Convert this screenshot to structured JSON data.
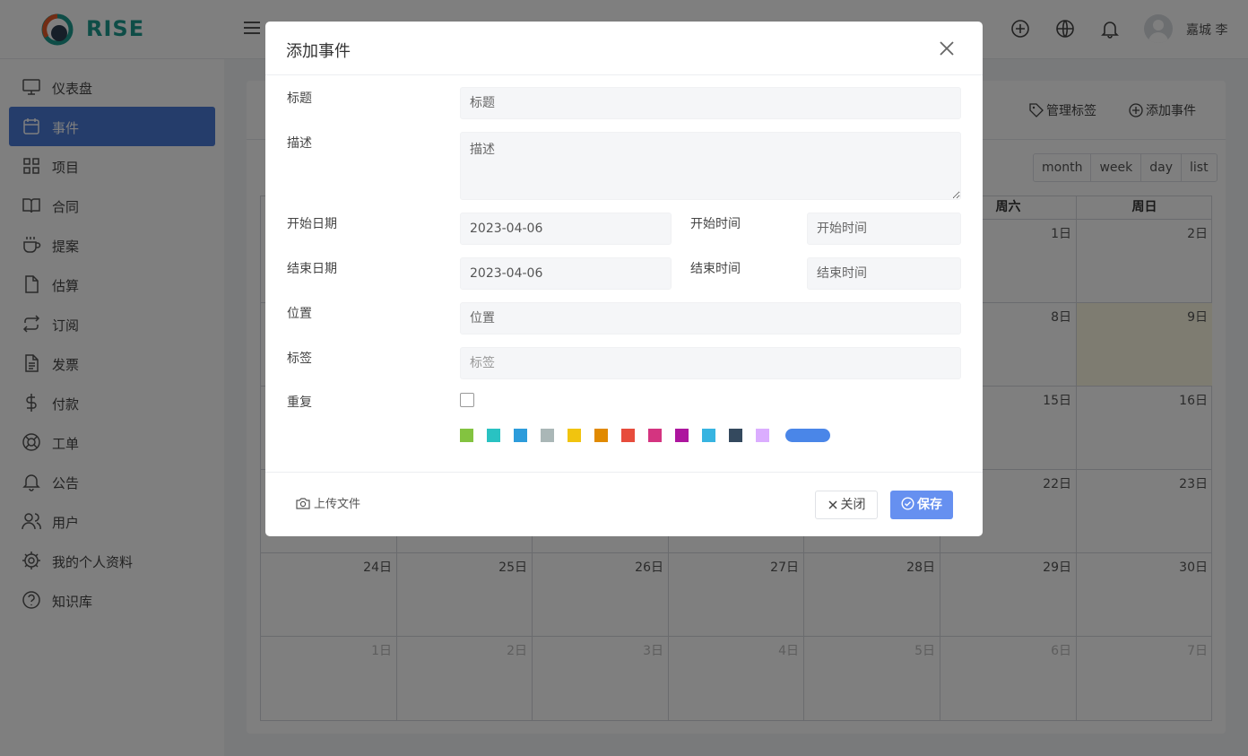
{
  "app": {
    "name": "RISE",
    "user_name": "嘉城 李"
  },
  "sidebar": {
    "items": [
      {
        "label": "仪表盘",
        "icon": "monitor-icon"
      },
      {
        "label": "事件",
        "icon": "calendar-icon",
        "active": true
      },
      {
        "label": "项目",
        "icon": "grid-icon"
      },
      {
        "label": "合同",
        "icon": "book-icon"
      },
      {
        "label": "提案",
        "icon": "coffee-icon"
      },
      {
        "label": "估算",
        "icon": "file-icon"
      },
      {
        "label": "订阅",
        "icon": "repeat-icon"
      },
      {
        "label": "发票",
        "icon": "file-text-icon"
      },
      {
        "label": "付款",
        "icon": "dollar-icon"
      },
      {
        "label": "工单",
        "icon": "life-buoy-icon"
      },
      {
        "label": "公告",
        "icon": "bell-icon"
      },
      {
        "label": "用户",
        "icon": "users-icon"
      },
      {
        "label": "我的个人资料",
        "icon": "settings-icon"
      },
      {
        "label": "知识库",
        "icon": "help-circle-icon"
      }
    ]
  },
  "events_page": {
    "manage_labels_label": "管理标签",
    "add_event_label": "添加事件",
    "view_buttons": [
      "month",
      "week",
      "day",
      "list"
    ],
    "weekday_headers": {
      "sat": "周六",
      "sun": "周日"
    },
    "weeks": [
      [
        "",
        "",
        "",
        "",
        "",
        "1日",
        "2日"
      ],
      [
        "",
        "",
        "",
        "",
        "",
        "8日",
        "9日"
      ],
      [
        "",
        "",
        "",
        "",
        "",
        "15日",
        "16日"
      ],
      [
        "",
        "",
        "",
        "",
        "",
        "22日",
        "23日"
      ],
      [
        "24日",
        "25日",
        "26日",
        "27日",
        "28日",
        "29日",
        "30日"
      ],
      [
        "1日",
        "2日",
        "3日",
        "4日",
        "5日",
        "6日",
        "7日"
      ]
    ],
    "today": "9日"
  },
  "modal": {
    "title": "添加事件",
    "fields": {
      "title": {
        "label": "标题",
        "placeholder": "标题"
      },
      "description": {
        "label": "描述",
        "placeholder": "描述"
      },
      "start_date": {
        "label": "开始日期",
        "value": "2023-04-06"
      },
      "start_time": {
        "label": "开始时间",
        "placeholder": "开始时间"
      },
      "end_date": {
        "label": "结束日期",
        "value": "2023-04-06"
      },
      "end_time": {
        "label": "结束时间",
        "placeholder": "结束时间"
      },
      "location": {
        "label": "位置",
        "placeholder": "位置"
      },
      "labels": {
        "label": "标签",
        "placeholder": "标签"
      },
      "repeat": {
        "label": "重复",
        "checked": false
      }
    },
    "colors": [
      "#83c340",
      "#29c2c2",
      "#2d9cdb",
      "#aab7b7",
      "#f1c40f",
      "#e18a00",
      "#e74c3c",
      "#d43480",
      "#ad159e",
      "#37b4e1",
      "#34495e",
      "#dbadff"
    ],
    "selected_color": "#4a86e8",
    "upload_label": "上传文件",
    "close_label": "关闭",
    "save_label": "保存"
  }
}
